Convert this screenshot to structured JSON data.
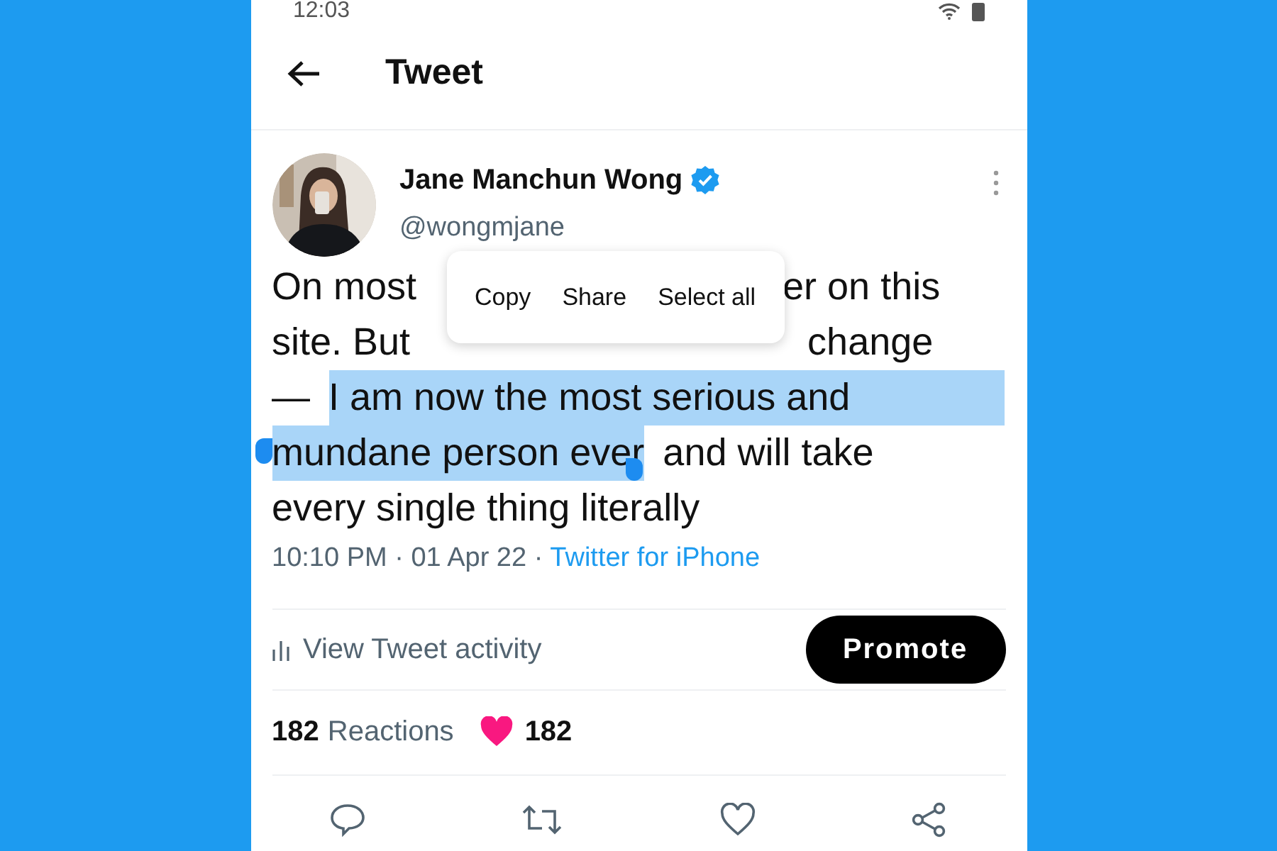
{
  "status_bar": {
    "time": "12:03"
  },
  "header": {
    "title": "Tweet"
  },
  "author": {
    "name": "Jane Manchun Wong",
    "verified": true,
    "handle": "@wongmjane"
  },
  "tweet_lines": [
    {
      "covered": true,
      "segments": [
        {
          "text": "On most",
          "selected": false
        },
        {
          "text": "er on this",
          "selected": false
        }
      ]
    },
    {
      "covered": true,
      "segments": [
        {
          "text": "site. But",
          "selected": false
        },
        {
          "text": "change",
          "selected": false
        }
      ]
    },
    {
      "covered": false,
      "segments": [
        {
          "text": "—",
          "selected": false
        },
        {
          "text": "I am now the most serious and",
          "selected": true
        }
      ]
    },
    {
      "covered": false,
      "segments": [
        {
          "text": "mundane person ever",
          "selected": true
        },
        {
          "text": "and will take",
          "selected": false
        }
      ]
    },
    {
      "covered": false,
      "segments": [
        {
          "text": "every single thing literally",
          "selected": false
        }
      ]
    }
  ],
  "context_menu": [
    "Copy",
    "Share",
    "Select all"
  ],
  "meta": {
    "time": "10:10 PM · 01 Apr 22 ·",
    "source": "Twitter for iPhone"
  },
  "activity": {
    "label": "View Tweet activity",
    "button": "Promote"
  },
  "reactions": {
    "count": "182",
    "label": "Reactions",
    "likes": "182"
  }
}
